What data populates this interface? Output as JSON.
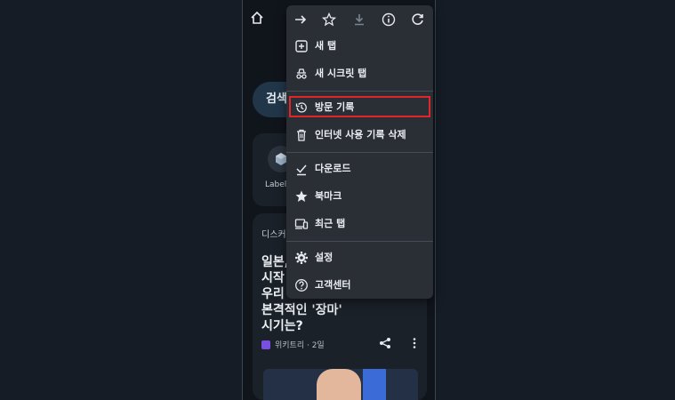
{
  "feed": {
    "search_pill": "검색",
    "shortcut_label": "Label",
    "discover_label": "디스커",
    "headline": "일본,\n시작\n우리\n본격적인 '장마'\n시기는?",
    "source": "위키트리 · 2일"
  },
  "menu": {
    "top_icons": [
      "forward-icon",
      "star-icon",
      "download-icon",
      "info-icon",
      "refresh-icon"
    ],
    "items": [
      {
        "label": "새 탭",
        "icon": "new-tab-icon"
      },
      {
        "label": "새 시크릿 탭",
        "icon": "incognito-icon"
      },
      {
        "label": "방문 기록",
        "icon": "history-icon"
      },
      {
        "label": "인터넷 사용 기록 삭제",
        "icon": "trash-icon"
      },
      {
        "label": "다운로드",
        "icon": "download-check-icon"
      },
      {
        "label": "북마크",
        "icon": "star-filled-icon"
      },
      {
        "label": "최근 탭",
        "icon": "devices-icon"
      },
      {
        "label": "설정",
        "icon": "gear-icon"
      },
      {
        "label": "고객센터",
        "icon": "help-icon"
      }
    ]
  },
  "colors": {
    "highlight": "#e0252b",
    "menu_bg": "#2a2f36",
    "page_bg": "#151c26"
  }
}
